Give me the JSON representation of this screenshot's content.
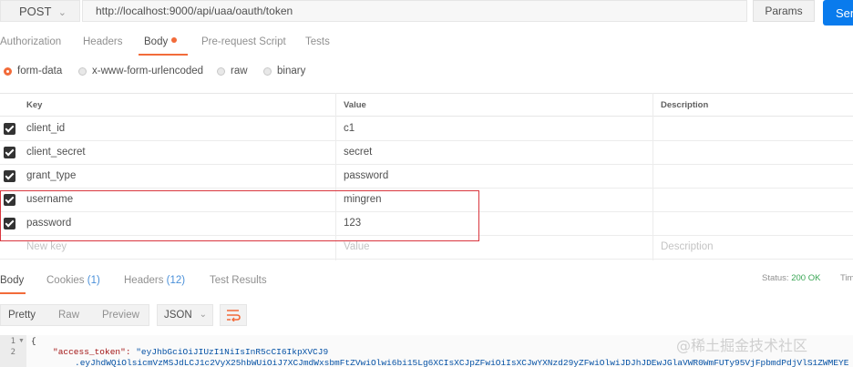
{
  "request": {
    "method": "POST",
    "url": "http://localhost:9000/api/uaa/oauth/token",
    "params_label": "Params",
    "send_label": "Send"
  },
  "request_tabs": [
    "Authorization",
    "Headers",
    "Body",
    "Pre-request Script",
    "Tests"
  ],
  "body_types": [
    "form-data",
    "x-www-form-urlencoded",
    "raw",
    "binary"
  ],
  "body_type_selected": "form-data",
  "table": {
    "headers": {
      "key": "Key",
      "value": "Value",
      "description": "Description"
    },
    "rows": [
      {
        "key": "client_id",
        "value": "c1",
        "checked": true
      },
      {
        "key": "client_secret",
        "value": "secret",
        "checked": true
      },
      {
        "key": "grant_type",
        "value": "password",
        "checked": true
      },
      {
        "key": "username",
        "value": "mingren",
        "checked": true
      },
      {
        "key": "password",
        "value": "123",
        "checked": true
      }
    ],
    "placeholder": {
      "key": "New key",
      "value": "Value",
      "description": "Description"
    }
  },
  "response_tabs": {
    "body": "Body",
    "cookies": "Cookies",
    "cookies_count": "(1)",
    "headers": "Headers",
    "headers_count": "(12)",
    "tests": "Test Results"
  },
  "status": {
    "label": "Status:",
    "value": "200 OK",
    "time_label": "Time"
  },
  "view_modes": [
    "Pretty",
    "Raw",
    "Preview"
  ],
  "format": "JSON",
  "code": {
    "line_numbers": [
      "1",
      "2"
    ],
    "line1": "{",
    "line2_key": "\"access_token\":",
    "line2_value": "\"eyJhbGciOiJIUzI1NiIsInR5cCI6IkpXVCJ9",
    "line3": ".eyJhdWQiOlsicmVzMSJdLCJ1c2VyX25hbWUiOiJ7XCJmdWxsbmFtZVwiOlwi6bi15Lg6XCIsXCJpZFwiOiIsXCJwYXNzd29yZFwiOlwiJDJhJDEwJGlaVWR0WmFUTy95VjFpbmdPdjVlS1ZWMEYE"
  },
  "watermark": "@稀土掘金技术社区"
}
